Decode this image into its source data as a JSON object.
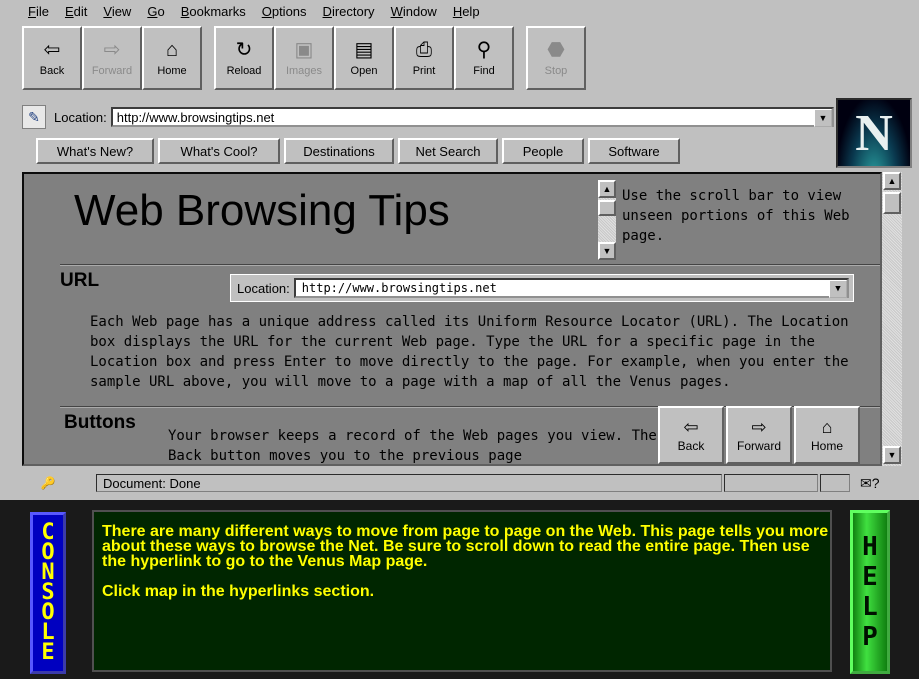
{
  "menu": [
    {
      "u": "F",
      "rest": "ile"
    },
    {
      "u": "E",
      "rest": "dit"
    },
    {
      "u": "V",
      "rest": "iew"
    },
    {
      "u": "G",
      "rest": "o"
    },
    {
      "u": "B",
      "rest": "ookmarks"
    },
    {
      "u": "O",
      "rest": "ptions"
    },
    {
      "u": "D",
      "rest": "irectory"
    },
    {
      "u": "W",
      "rest": "indow"
    },
    {
      "u": "H",
      "rest": "elp"
    }
  ],
  "toolbar": {
    "back": "Back",
    "forward": "Forward",
    "home": "Home",
    "reload": "Reload",
    "images": "Images",
    "open": "Open",
    "print": "Print",
    "find": "Find",
    "stop": "Stop"
  },
  "location": {
    "label": "Location:",
    "url": "http://www.browsingtips.net"
  },
  "directory_buttons": [
    "What's New?",
    "What's Cool?",
    "Destinations",
    "Net Search",
    "People",
    "Software"
  ],
  "logo_letter": "N",
  "content": {
    "title": "Web Browsing Tips",
    "tip": "Use the scroll bar to view unseen portions of this Web page.",
    "url_heading": "URL",
    "url_location_label": "Location:",
    "url_location_value": "http://www.browsingtips.net",
    "url_paragraph": "Each Web page has a unique address called its Uniform Resource Locator (URL).  The Location box displays the URL for the current Web page. Type the URL for a specific page in the Location box and press Enter to move directly to the page.  For example, when you enter the sample URL above, you will move to a page with a map of all the Venus pages.",
    "buttons_heading": "Buttons",
    "buttons_paragraph": "Your browser keeps a record of the Web pages you view.  The Back button moves you to the previous page",
    "content_buttons": {
      "back": "Back",
      "forward": "Forward",
      "home": "Home"
    }
  },
  "status": {
    "text": "Document: Done"
  },
  "console": {
    "label_letters": [
      "C",
      "O",
      "N",
      "S",
      "O",
      "L",
      "E"
    ],
    "text": "There are many different ways to move from page to page on the Web.  This page tells you more about these ways to browse the Net. Be sure to scroll down to read the entire page.  Then use the hyperlink to go to the Venus Map page.",
    "instruction": "Click map in the hyperlinks section."
  },
  "help": {
    "label_letters": [
      "H",
      "E",
      "L",
      "P"
    ]
  },
  "colors": {
    "console_text": "#ffff00",
    "console_bg": "#002600",
    "console_bar": "#0000c0",
    "help_bar": "#40e040"
  }
}
